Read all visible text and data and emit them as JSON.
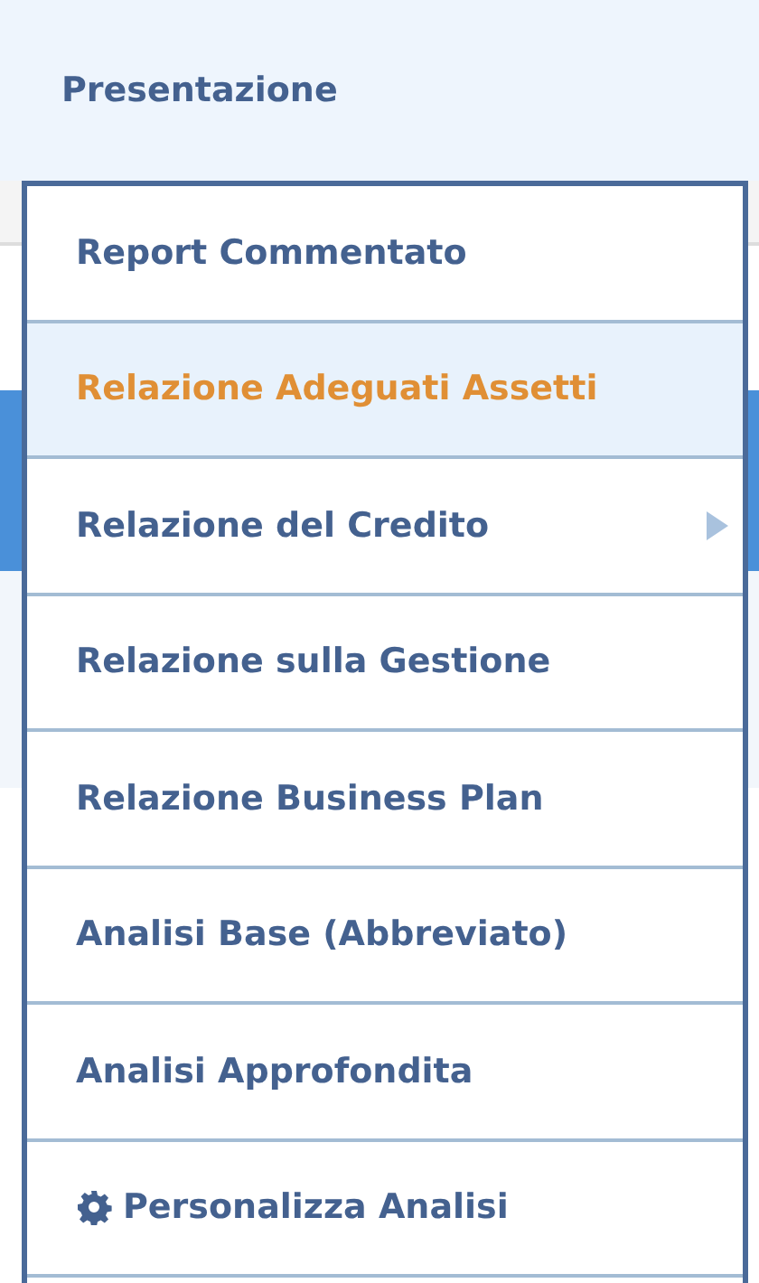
{
  "header": {
    "title": "Presentazione"
  },
  "menu": {
    "items": [
      {
        "label": "Report Commentato",
        "kind": "plain",
        "selected": false
      },
      {
        "label": "Relazione Adeguati Assetti",
        "kind": "plain",
        "selected": true
      },
      {
        "label": "Relazione del Credito",
        "kind": "submenu",
        "selected": false
      },
      {
        "label": "Relazione sulla Gestione",
        "kind": "plain",
        "selected": false
      },
      {
        "label": "Relazione Business Plan",
        "kind": "plain",
        "selected": false
      },
      {
        "label": "Analisi Base (Abbreviato)",
        "kind": "plain",
        "selected": false
      },
      {
        "label": "Analisi Approfondita",
        "kind": "plain",
        "selected": false
      },
      {
        "label": "Personalizza Analisi",
        "kind": "settings",
        "selected": false
      }
    ]
  }
}
